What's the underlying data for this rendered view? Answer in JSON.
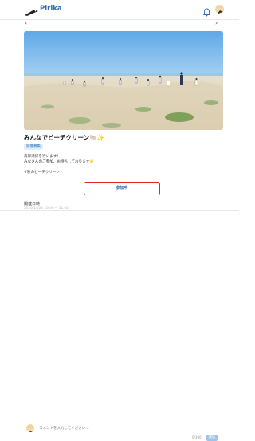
{
  "header": {
    "brand": "Pirika",
    "logo_icon": "pirika-bird-logo-icon",
    "notification_icon": "bell-icon",
    "accent": "#2f6fb5"
  },
  "nav": {
    "back_glyph": "‹",
    "forward_glyph": "›"
  },
  "post": {
    "photo_alt": "beach-cleanup-photo",
    "title": "みんなでビーチクリーン🐚✨",
    "badge": "開催募集",
    "description_line1": "海岸清掃を行います！",
    "description_line2": "みなさんのご参加、お待ちしております🌟",
    "hashtag": "#秋のビーチクリーン",
    "join_button": "参加中",
    "section_label": "開催日時",
    "section_value_partial": "2020/10/24 10:00 ~ 11:00"
  },
  "comment": {
    "placeholder": "コメントを入力してください…",
    "counter": "0/300",
    "send_button": "送信"
  },
  "colors": {
    "highlight_border": "#e0262a",
    "send_button": "#9ec3ea",
    "badge_bg": "#e4eefa"
  }
}
